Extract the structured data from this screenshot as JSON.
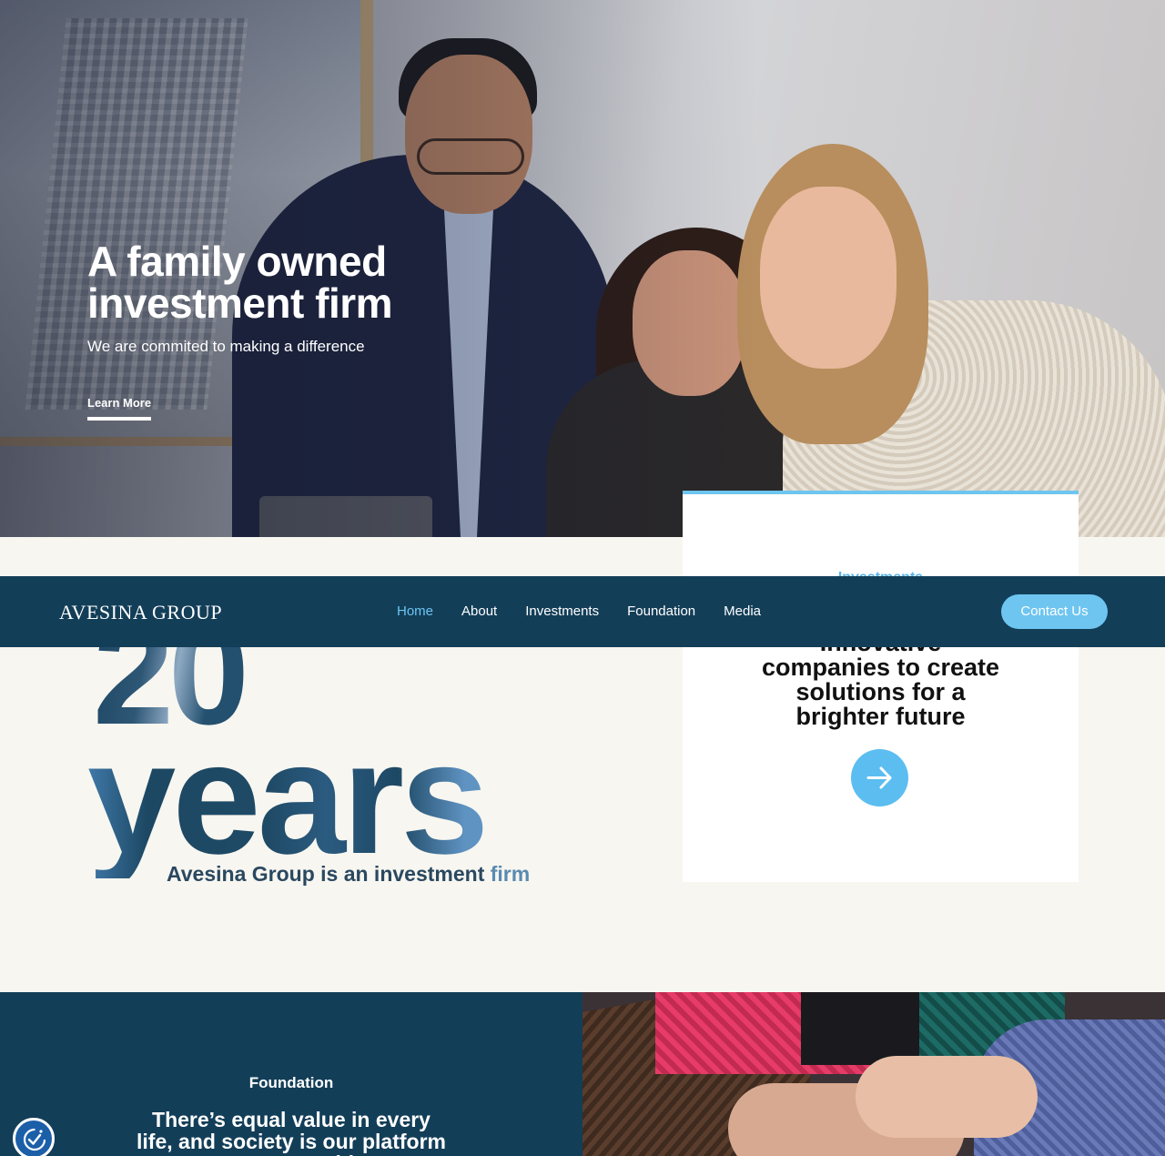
{
  "hero": {
    "title_line1": "A family owned",
    "title_line2": "investment firm",
    "subtitle": "We are commited to making a difference",
    "cta": "Learn More"
  },
  "nav": {
    "logo": "AVESINA GROUP",
    "links": [
      "Home",
      "About",
      "Investments",
      "Foundation",
      "Media"
    ],
    "active": "Home",
    "contact": "Contact Us"
  },
  "card": {
    "label": "Investments",
    "text_line1": "Innovative",
    "text_line2": "companies to create",
    "text_line3": "solutions for a",
    "text_line4": "brighter future",
    "arrow_icon": "arrow-right-icon"
  },
  "years": {
    "number": "20",
    "word": "years",
    "subtitle_main": "Avesina Group is an investment ",
    "subtitle_accent": "firm"
  },
  "foundation": {
    "label": "Foundation",
    "text": "There’s equal value in every life, and society is our platform to create positive"
  },
  "colors": {
    "navy": "#133e58",
    "accent": "#6ec5f0",
    "cream": "#f7f6f0"
  }
}
